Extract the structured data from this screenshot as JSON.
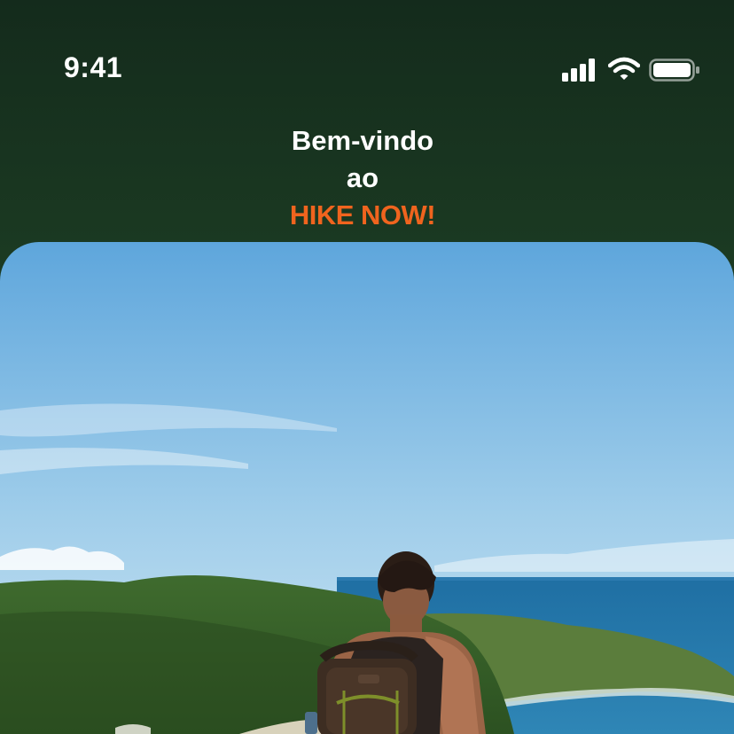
{
  "status_bar": {
    "time": "9:41",
    "icons": [
      "signal-icon",
      "wifi-icon",
      "battery-icon"
    ]
  },
  "header": {
    "line1": "Bem-vindo",
    "line2": "ao",
    "brand": "HIKE NOW!"
  },
  "hero_image": {
    "description_icon": "hiker-photo"
  },
  "colors": {
    "background": "#1b3a22",
    "brand_accent": "#f0641e",
    "text": "#ffffff"
  }
}
